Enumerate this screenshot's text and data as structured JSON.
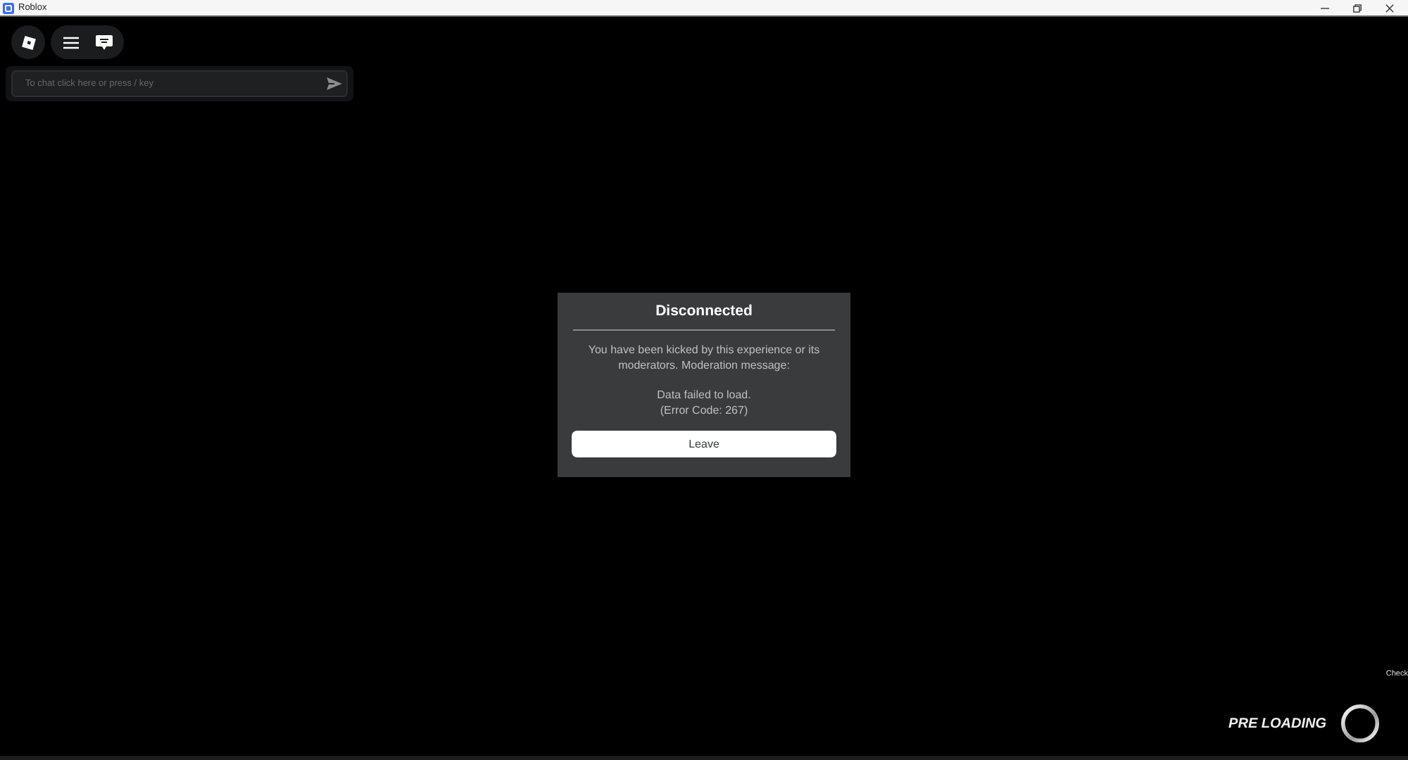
{
  "window": {
    "title": "Roblox"
  },
  "chat": {
    "placeholder": "To chat click here or press / key"
  },
  "dialog": {
    "title": "Disconnected",
    "message": "You have been kicked by this experience or its moderators. Moderation message:",
    "detail": [
      "Data failed to load.",
      "(Error Code: 267)"
    ],
    "buttons": [
      "Leave"
    ]
  },
  "loading": {
    "label": "PRE LOADING",
    "edge_text": "Check"
  }
}
